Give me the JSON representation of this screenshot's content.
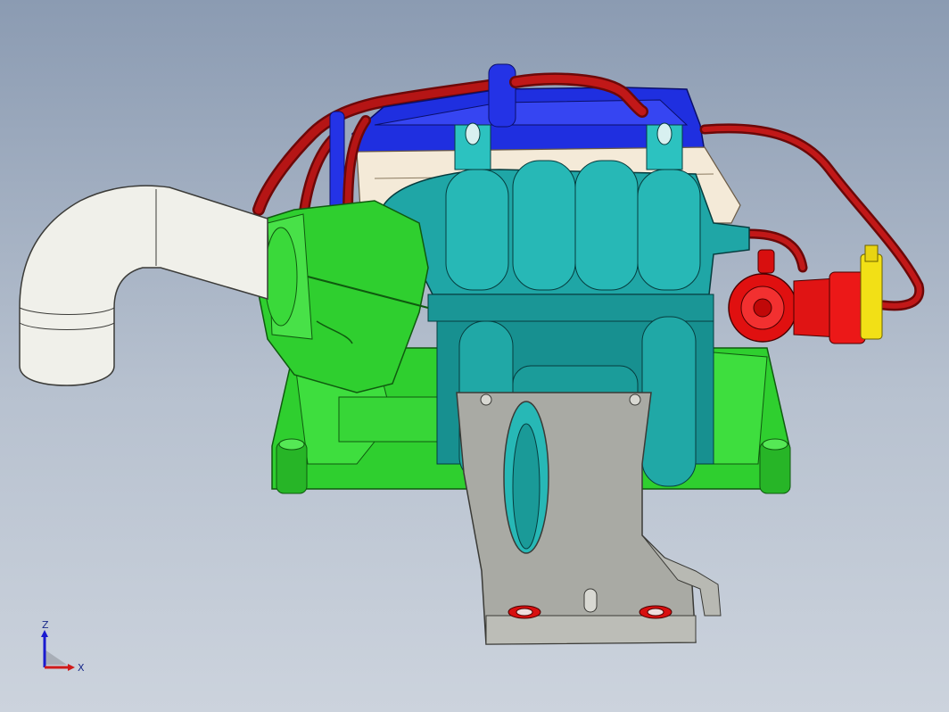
{
  "viewport": {
    "background_top": "#8b9bb2",
    "background_bottom": "#ccd3dd"
  },
  "colors": {
    "manifold_teal": "#1fa6a6",
    "manifold_teal_dark": "#0d6f72",
    "base_green": "#2fcf2f",
    "base_green_dark": "#158a15",
    "cover_blue": "#1f2fe0",
    "hose_red": "#a80f0f",
    "valve_red": "#e01010",
    "connector_yellow": "#f2e016",
    "intake_pipe_white": "#f0f0ea",
    "bracket_gray": "#a9aaa4",
    "cover_cream": "#f4ead8"
  },
  "triad": {
    "z_label": "Z",
    "x_label": "X"
  }
}
